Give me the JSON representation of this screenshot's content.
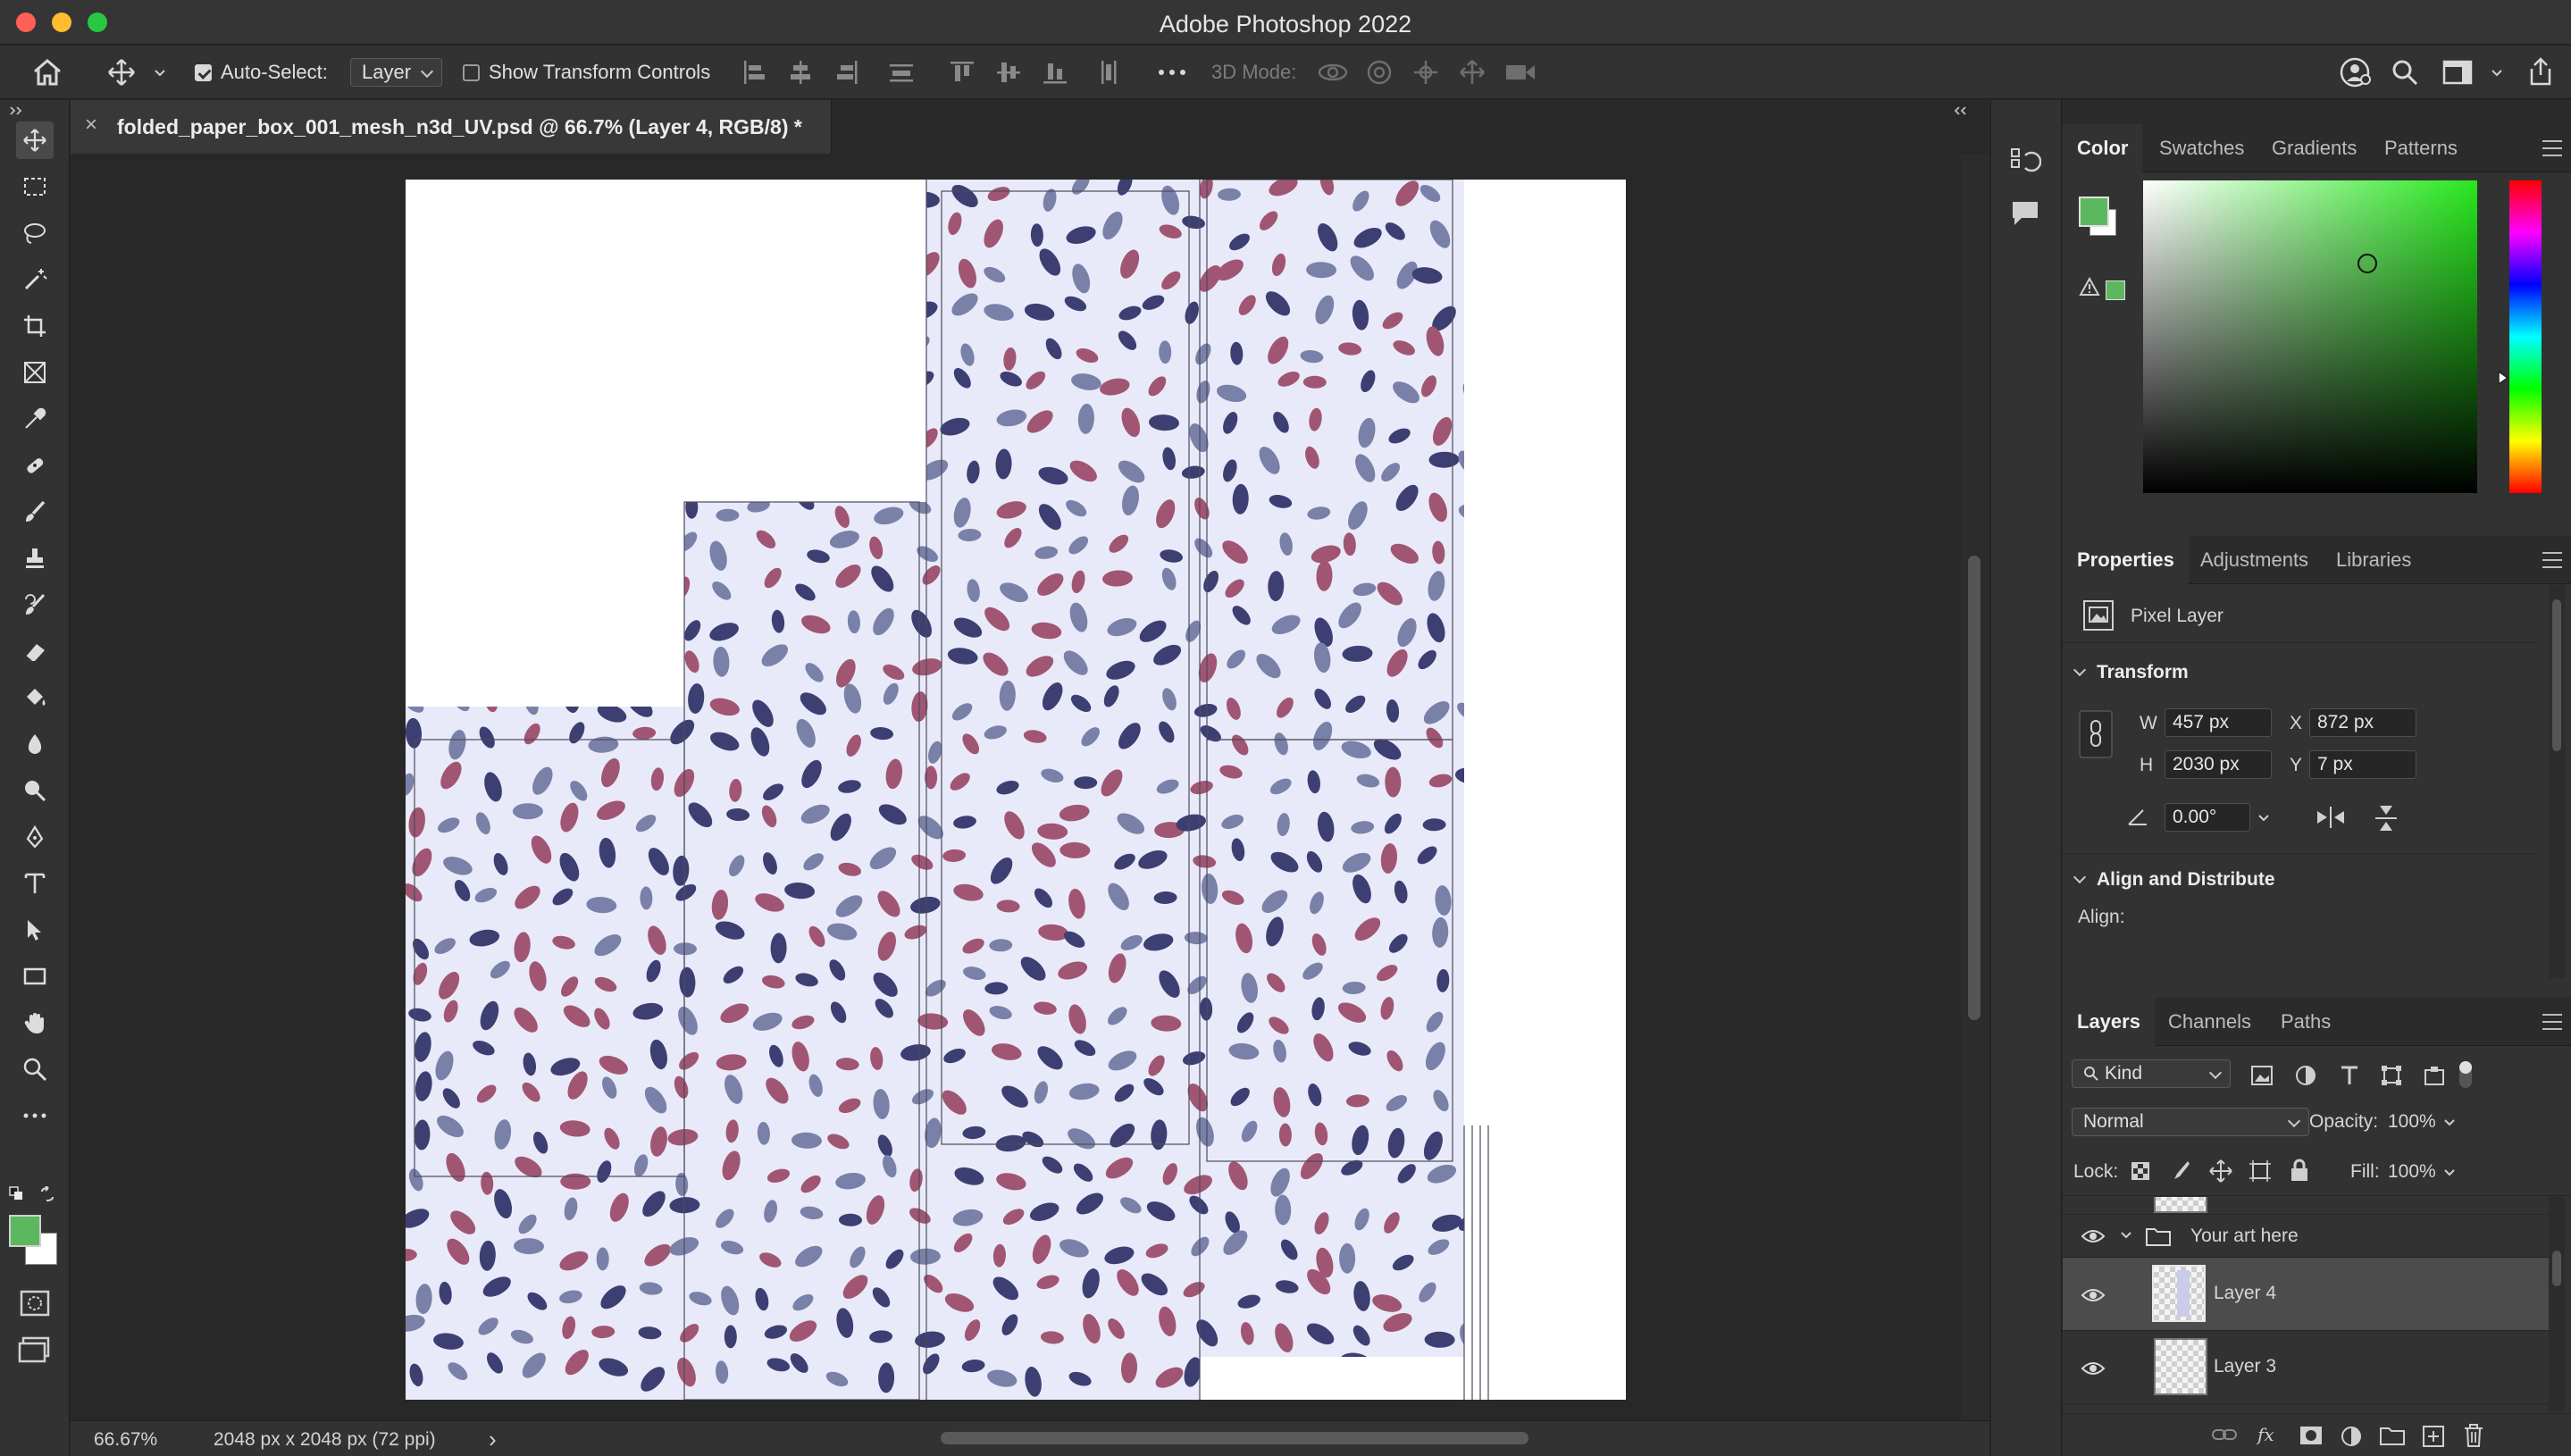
{
  "app": {
    "title": "Adobe Photoshop 2022"
  },
  "options_bar": {
    "auto_select_label": "Auto-Select:",
    "auto_select_checked": true,
    "auto_select_target": "Layer",
    "show_transform_label": "Show Transform Controls",
    "show_transform_checked": false,
    "three_d_mode_label": "3D Mode:"
  },
  "document": {
    "tab_label": "folded_paper_box_001_mesh_n3d_UV.psd @ 66.7% (Layer 4, RGB/8) *",
    "close_glyph": "×"
  },
  "status": {
    "zoom": "66.67%",
    "doc_info": "2048 px x 2048 px (72 ppi)",
    "arrow": "›"
  },
  "tools": [
    "move-tool",
    "rectangular-marquee-tool",
    "lasso-tool",
    "magic-wand-tool",
    "crop-tool",
    "frame-tool",
    "eyedropper-tool",
    "healing-brush-tool",
    "brush-tool",
    "clone-stamp-tool",
    "history-brush-tool",
    "eraser-tool",
    "paint-bucket-tool",
    "blur-tool",
    "dodge-tool",
    "pen-tool",
    "type-tool",
    "path-selection-tool",
    "rectangle-tool",
    "hand-tool",
    "zoom-tool",
    "more-tools"
  ],
  "colors": {
    "foreground": "#5cb85f",
    "background": "#ffffff",
    "accent": "#5cb85f",
    "pattern_bg": "#e9eaf9",
    "petal_mauve": "#a05672",
    "petal_navy": "#3d3f73",
    "petal_slate": "#7a81a8"
  },
  "color_panel": {
    "tabs": [
      "Color",
      "Swatches",
      "Gradients",
      "Patterns"
    ],
    "active": "Color"
  },
  "properties_panel": {
    "tabs": [
      "Properties",
      "Adjustments",
      "Libraries"
    ],
    "layer_type": "Pixel Layer",
    "transform_title": "Transform",
    "w_label": "W",
    "w_value": "457 px",
    "h_label": "H",
    "h_value": "2030 px",
    "x_label": "X",
    "x_value": "872 px",
    "y_label": "Y",
    "y_value": "7 px",
    "angle_value": "0.00°",
    "align_title": "Align and Distribute",
    "align_label": "Align:"
  },
  "layers_panel": {
    "tabs": [
      "Layers",
      "Channels",
      "Paths"
    ],
    "filter_kind": "Kind",
    "blend_mode": "Normal",
    "opacity_label": "Opacity:",
    "opacity_value": "100%",
    "lock_label": "Lock:",
    "fill_label": "Fill:",
    "fill_value": "100%",
    "group_name": "Your art here",
    "layers": [
      {
        "name": "Layer 4",
        "selected": true
      },
      {
        "name": "Layer 3",
        "selected": false
      }
    ]
  }
}
